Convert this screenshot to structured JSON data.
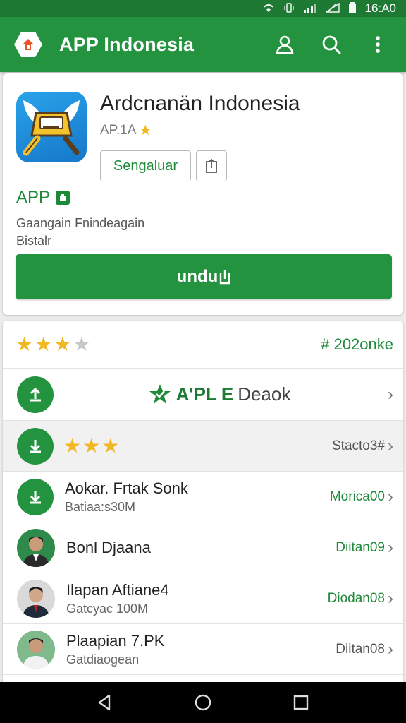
{
  "status_bar": {
    "time": "16:A0"
  },
  "app_bar": {
    "title": "APP Indonesia",
    "icons": [
      "home-logo-icon",
      "profile-icon",
      "search-icon",
      "overflow-menu-icon"
    ]
  },
  "app_card": {
    "name": "Ardcnanän Indonesia",
    "meta": "AP.1A",
    "secondary_button": "Sengaluar",
    "tag": "APP",
    "description_line1": "Gaangain Fnindeagain",
    "description_line2": "Bistalr",
    "primary_button": "undu"
  },
  "ratings": {
    "stars_filled": 3,
    "stars_total": 4,
    "count": "# 202onke"
  },
  "list": {
    "featured": {
      "prefix": "A'PL",
      "highlight": "E",
      "suffix": "Deaok"
    },
    "rating_row": {
      "stars": 3,
      "right": "Stacto3#"
    },
    "items": [
      {
        "name": "Aokar. Frtak Sonk",
        "sub": "Batiaa:s30M",
        "right": "Morica00"
      },
      {
        "name": "Bonl Djaana",
        "sub": "",
        "right": "Diitan09"
      },
      {
        "name": "Ilapan Aftiane4",
        "sub": "Gatcyac 100M",
        "right": "Diodan08"
      },
      {
        "name": "Plaapian 7.PK",
        "sub": "Gatdiaogean",
        "right": "Diitan08"
      }
    ]
  },
  "colors": {
    "primary": "#23933f",
    "primary_dark": "#1e7a33",
    "star": "#f2b823"
  }
}
